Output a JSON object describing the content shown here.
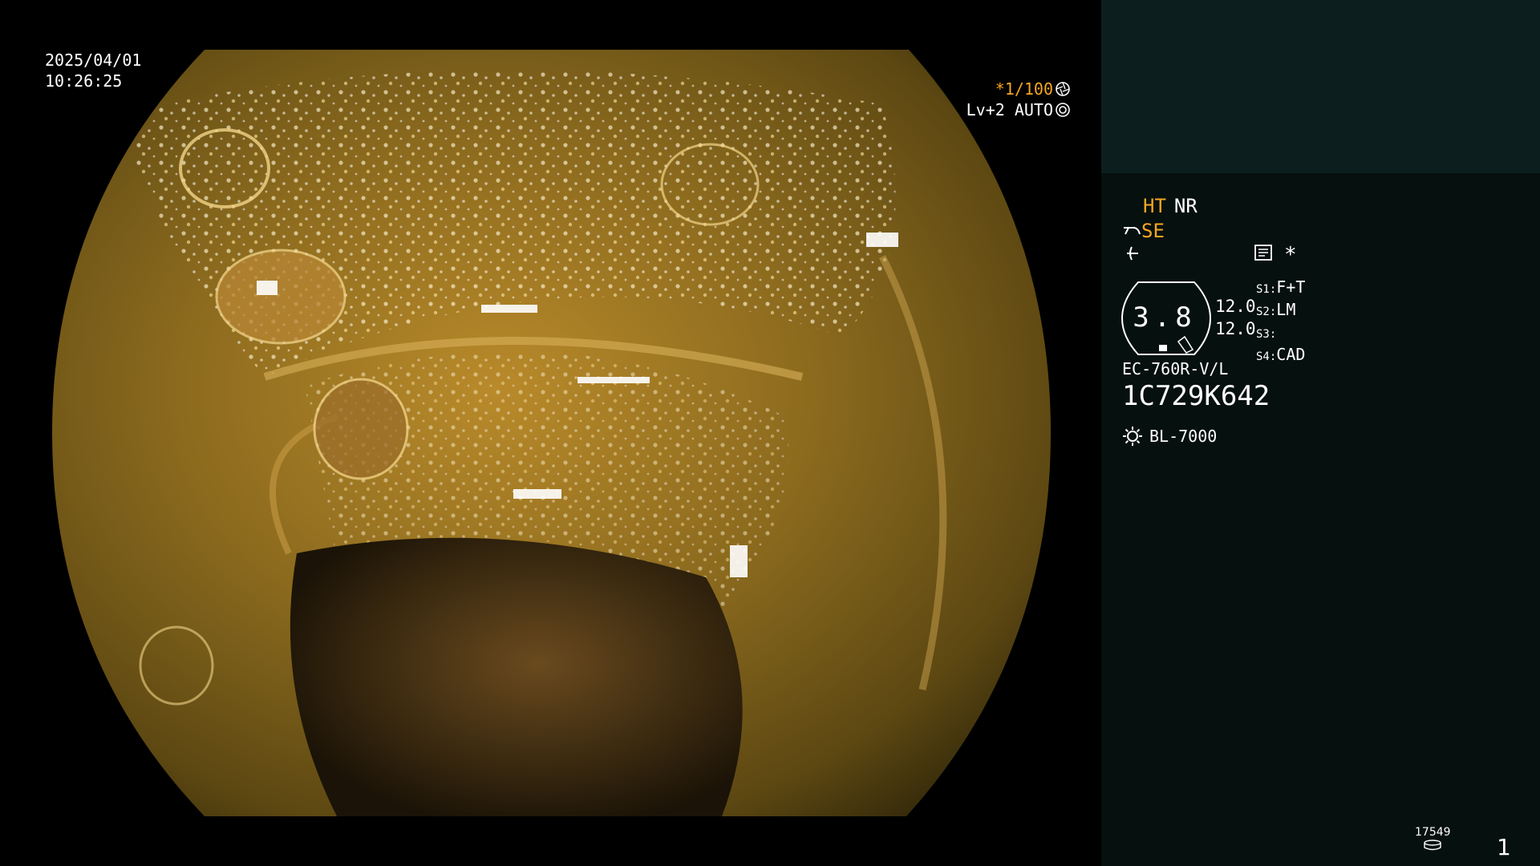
{
  "overlay": {
    "date": "2025/04/01",
    "time": "10:26:25",
    "shutter_prefix": "*1/100",
    "level_mode": "Lv+2 AUTO",
    "icons": [
      "aperture-icon",
      "iris-icon"
    ]
  },
  "panel": {
    "enhance": {
      "ht": "HT",
      "nr": "NR"
    },
    "se": "SE",
    "star": "*",
    "gauge_value": "3.8",
    "zoom_values": [
      "12.0",
      "12.0"
    ],
    "switches": [
      {
        "label": "S1:",
        "value": "F+T"
      },
      {
        "label": "S2:",
        "value": "LM"
      },
      {
        "label": "S3:",
        "value": ""
      },
      {
        "label": "S4:",
        "value": "CAD"
      }
    ],
    "scope_model": "EC-760R-V/L",
    "scope_serial": "1C729K642",
    "light_source": "BL-7000",
    "counter": "17549",
    "page_number": "1",
    "icons": [
      "scope-curve-icon",
      "flex-icon",
      "memo-icon",
      "sun-icon",
      "storage-icon"
    ]
  },
  "colors": {
    "accent_orange": "#f5a623",
    "panel_top": "#0c1f1e",
    "panel_bg": "#06100f",
    "text": "#ffffff"
  }
}
